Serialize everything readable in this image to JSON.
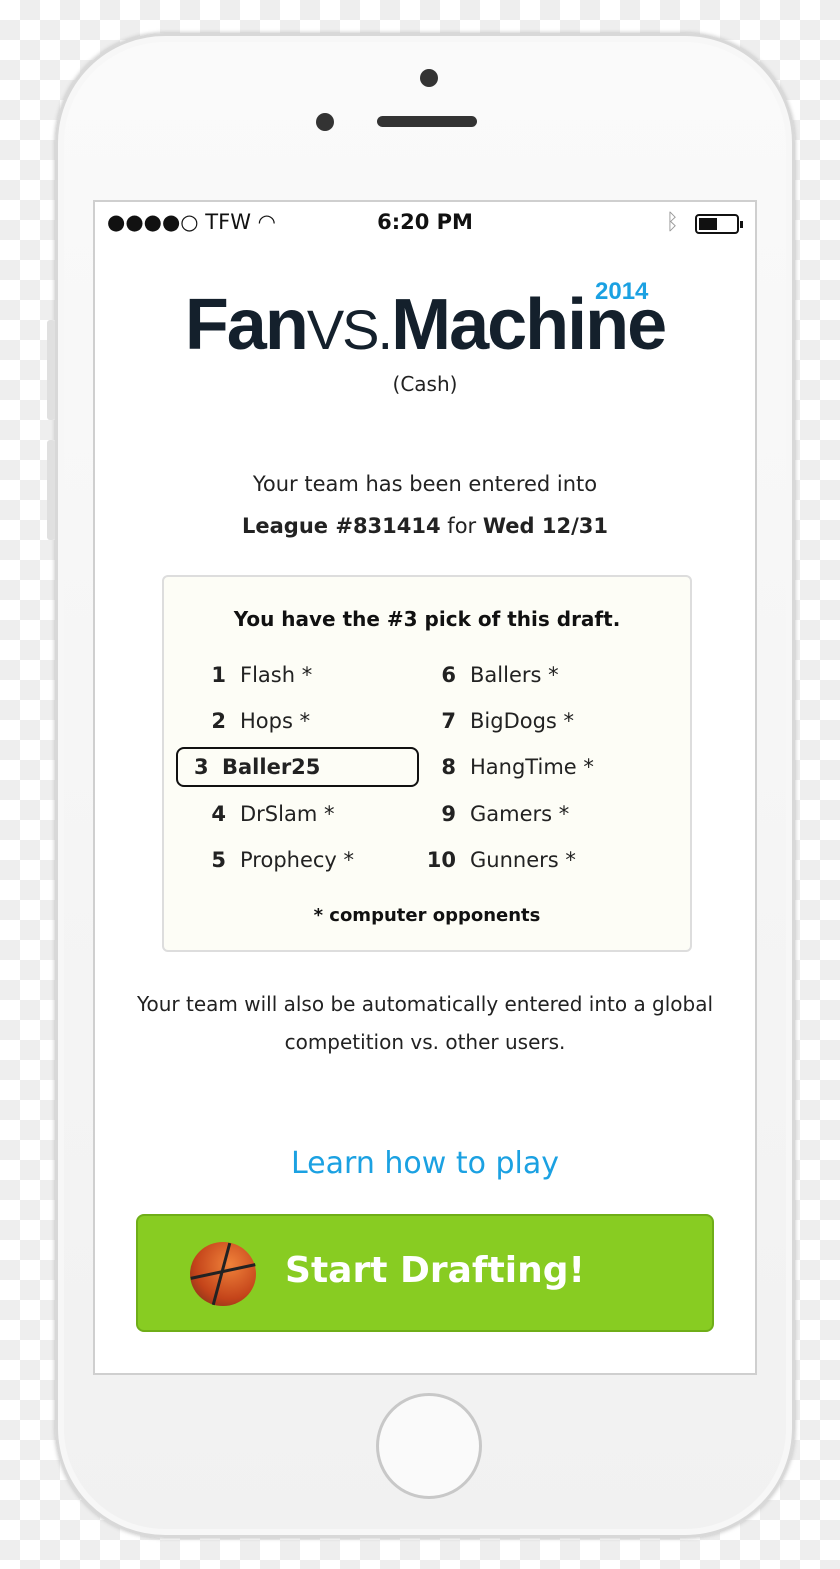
{
  "status": {
    "carrier": "●●●●○ TFW",
    "wifi": "wifi-icon",
    "time": "6:20 PM",
    "bluetooth": "bluetooth-icon",
    "battery_level": 0.45
  },
  "logo": {
    "fan": "Fan",
    "vs": "VS.",
    "machine": "Machine",
    "year": "2014",
    "mode": "(Cash)"
  },
  "entry": {
    "line1": "Your team has been entered into",
    "league": "League #831414",
    "for": " for ",
    "date": "Wed 12/31"
  },
  "draft": {
    "title": "You have the #3 pick of this draft.",
    "picks": [
      {
        "n": "1",
        "name": "Flash *"
      },
      {
        "n": "2",
        "name": "Hops *"
      },
      {
        "n": "3",
        "name": "Baller25"
      },
      {
        "n": "4",
        "name": "DrSlam *"
      },
      {
        "n": "5",
        "name": "Prophecy *"
      },
      {
        "n": "6",
        "name": "Ballers *"
      },
      {
        "n": "7",
        "name": "BigDogs *"
      },
      {
        "n": "8",
        "name": "HangTime *"
      },
      {
        "n": "9",
        "name": "Gamers *"
      },
      {
        "n": "10",
        "name": "Gunners *"
      }
    ],
    "note": "* computer opponents"
  },
  "global_note": "Your team will also be automatically entered into a global competition vs. other users.",
  "learn_link": "Learn how to play",
  "start_button": "Start Drafting!",
  "colors": {
    "accent": "#1ba1e2",
    "button": "#88cc22",
    "logo": "#14202c"
  }
}
